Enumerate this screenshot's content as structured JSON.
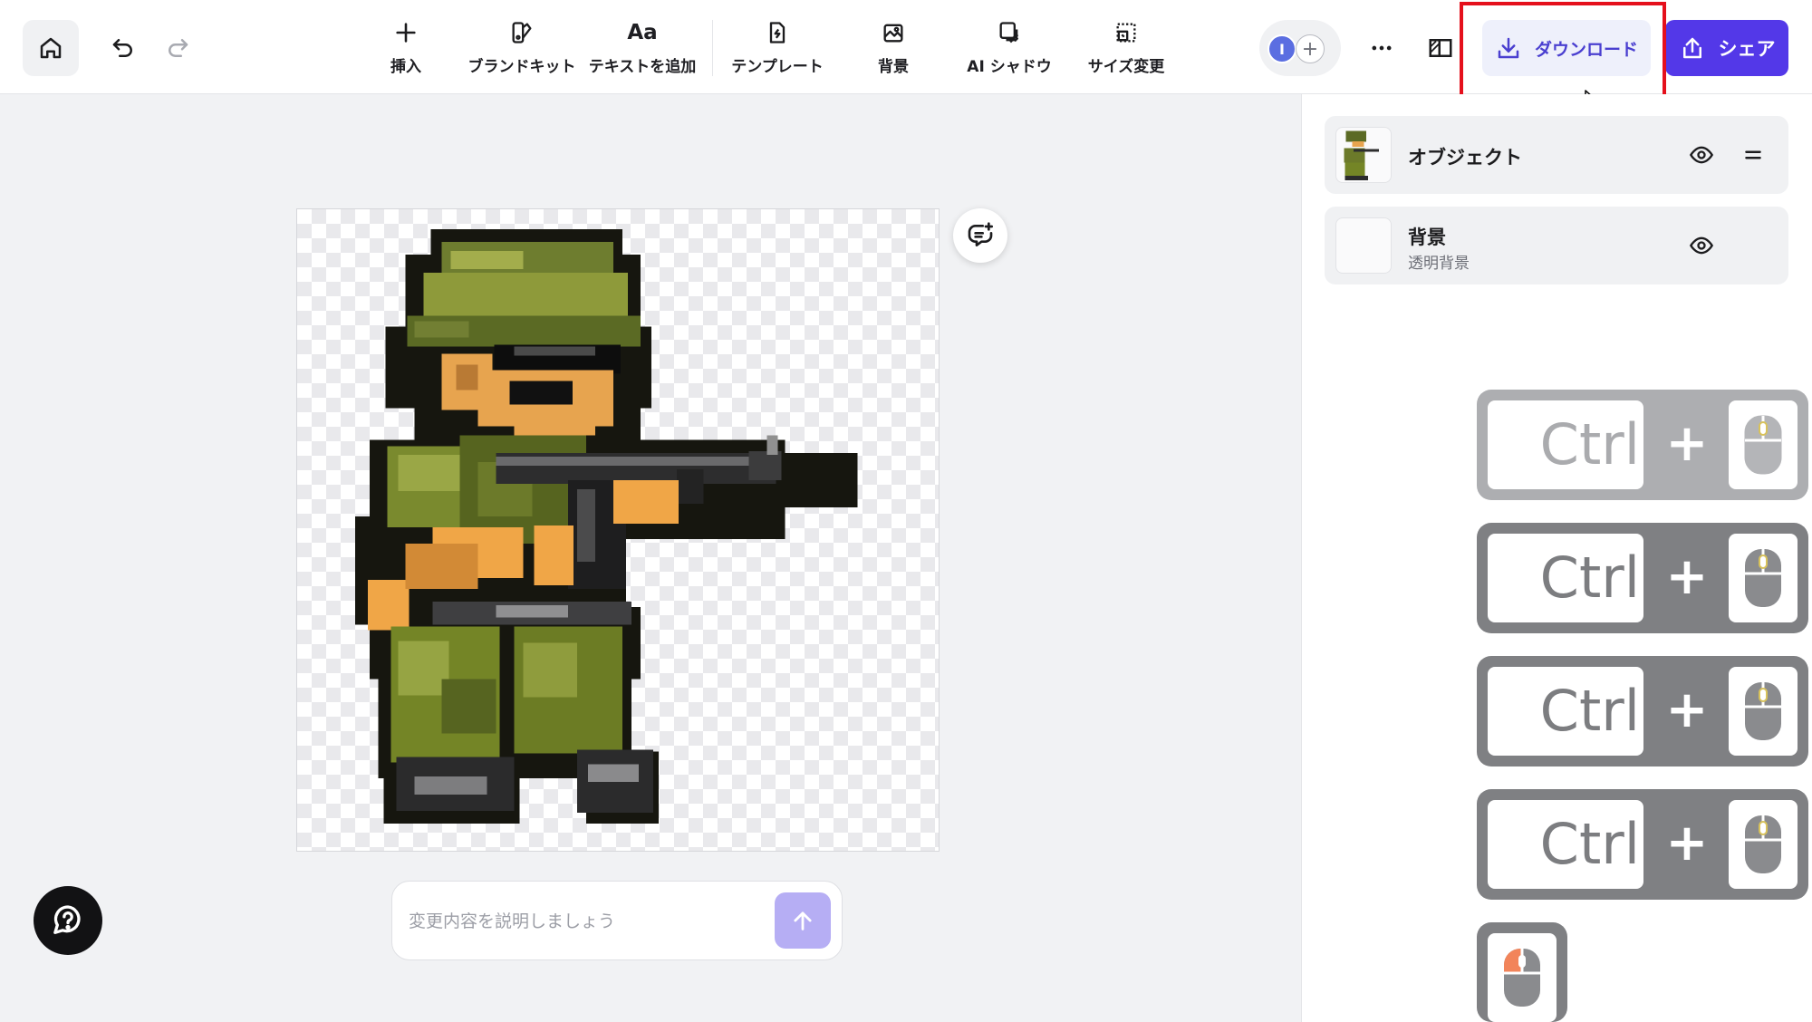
{
  "toolbar": {
    "home_icon": "home-icon",
    "undo_icon": "undo-icon",
    "redo_icon": "redo-icon",
    "tools": [
      {
        "label": "挿入",
        "icon": "plus-icon"
      },
      {
        "label": "ブランドキット",
        "icon": "brand-kit-icon"
      },
      {
        "label": "テキストを追加",
        "icon": "text-icon",
        "glyph": "Aa"
      },
      {
        "label": "テンプレート",
        "icon": "template-icon"
      },
      {
        "label": "背景",
        "icon": "background-icon"
      },
      {
        "label": "AI シャドウ",
        "icon": "ai-shadow-icon"
      },
      {
        "label": "サイズ変更",
        "icon": "resize-icon"
      }
    ],
    "avatar_initial": "I",
    "add_collaborator": "+",
    "download_label": "ダウンロード",
    "share_label": "シェア"
  },
  "prompt": {
    "placeholder": "変更内容を説明しましょう"
  },
  "layers": [
    {
      "name": "オブジェクト",
      "subtitle": ""
    },
    {
      "name": "背景",
      "subtitle": "透明背景"
    }
  ],
  "key_hints": [
    {
      "key": "Ctrl",
      "plus": "+"
    },
    {
      "key": "Ctrl",
      "plus": "+"
    },
    {
      "key": "Ctrl",
      "plus": "+"
    },
    {
      "key": "Ctrl",
      "plus": "+"
    }
  ],
  "colors": {
    "accent": "#5338e8",
    "download_bg": "#eef0fb",
    "highlight": "#e5101c",
    "send_button": "#b6aef4"
  }
}
